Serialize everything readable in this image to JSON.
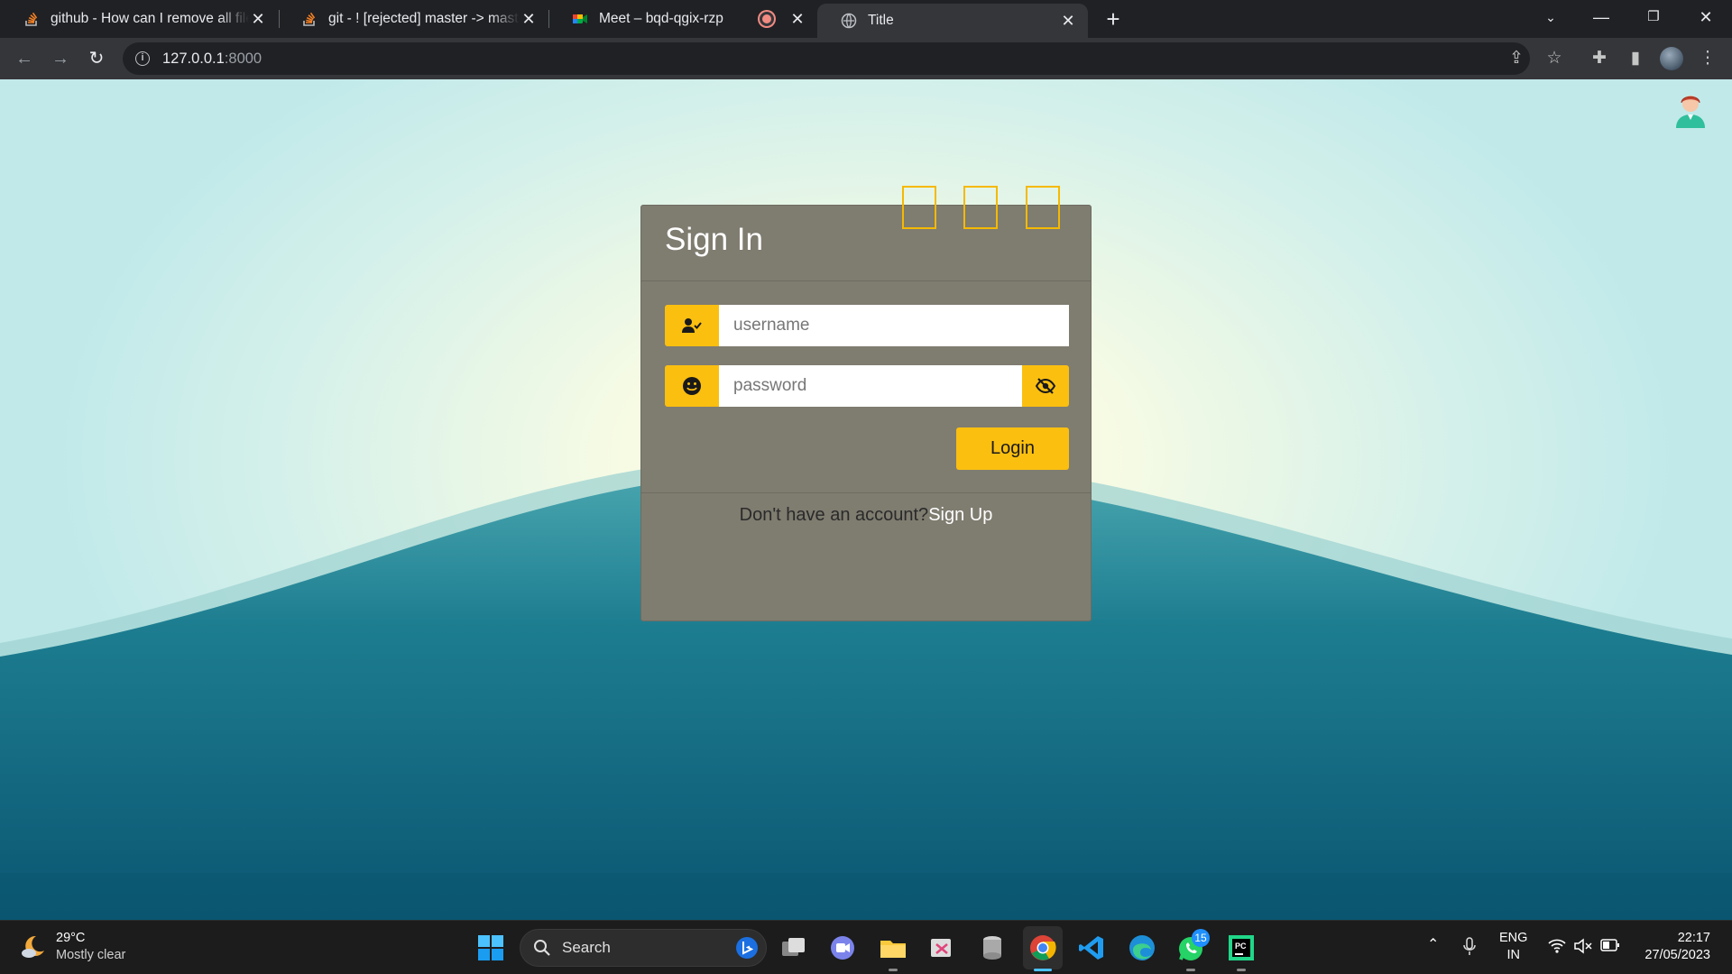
{
  "browser": {
    "tabs": [
      {
        "title": "github - How can I remove all files",
        "icon": "stackoverflow-icon"
      },
      {
        "title": "git - ! [rejected] master -> master",
        "icon": "stackoverflow-icon"
      },
      {
        "title": "Meet – bqd-qgix-rzp",
        "icon": "google-meet-icon",
        "recording": true
      },
      {
        "title": "Title",
        "icon": "globe-icon",
        "active": true
      }
    ],
    "url_host": "127.0.0.1",
    "url_port": ":8000"
  },
  "login_card": {
    "title": "Sign In",
    "username_placeholder": "username",
    "password_placeholder": "password",
    "login_label": "Login",
    "signup_prompt": "Don't have an account?",
    "signup_link": "Sign Up"
  },
  "taskbar": {
    "weather_temp": "29°C",
    "weather_condition": "Mostly clear",
    "search_label": "Search",
    "whatsapp_badge": "15",
    "language": "ENG",
    "region": "IN",
    "time": "22:17",
    "date": "27/05/2023"
  },
  "colors": {
    "accent": "#fbbf10",
    "card": "#7f7c70",
    "wave": "#1d6f82"
  }
}
